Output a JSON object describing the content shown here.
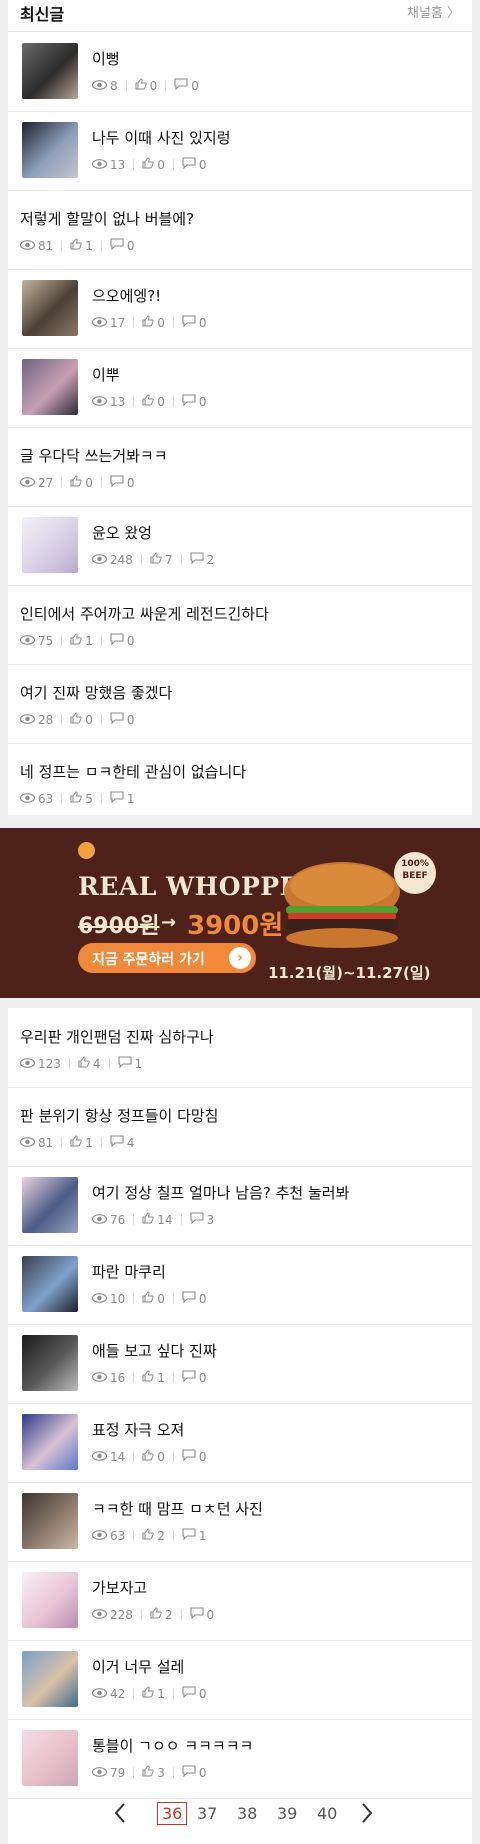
{
  "header": {
    "title": "최신글",
    "home_link": "채널홈 〉"
  },
  "list1": [
    {
      "title": "이뻥",
      "views": "8",
      "likes": "0",
      "comments": "0",
      "thumb": true,
      "colors": [
        "#6b6b6b",
        "#2a2a2a",
        "#b9a69a"
      ]
    },
    {
      "title": "나두 이때 사진 있지렁",
      "views": "13",
      "likes": "0",
      "comments": "0",
      "thumb": true,
      "colors": [
        "#1d2230",
        "#8e9fb8",
        "#c7c2cf"
      ]
    },
    {
      "title": "저렇게 할말이 없나 버블에?",
      "views": "81",
      "likes": "1",
      "comments": "0",
      "thumb": false
    },
    {
      "title": "으오에엥?!",
      "views": "17",
      "likes": "0",
      "comments": "0",
      "thumb": true,
      "colors": [
        "#c4b49f",
        "#4b3f36",
        "#8a7a6c"
      ]
    },
    {
      "title": "이뿌",
      "views": "13",
      "likes": "0",
      "comments": "0",
      "thumb": true,
      "colors": [
        "#6c6580",
        "#c7a0b4",
        "#2d2c34"
      ]
    },
    {
      "title": "글 우다닥 쓰는거봐ㅋㅋ",
      "views": "27",
      "likes": "0",
      "comments": "0",
      "thumb": false
    },
    {
      "title": "윤오 왔엉",
      "views": "248",
      "likes": "7",
      "comments": "2",
      "thumb": true,
      "colors": [
        "#f3f0f6",
        "#d9d2e6",
        "#b8abc9"
      ]
    },
    {
      "title": "인티에서 주어까고 싸운게 레전드긴하다",
      "views": "75",
      "likes": "1",
      "comments": "0",
      "thumb": false
    },
    {
      "title": "여기 진짜 망했음 좋겠다",
      "views": "28",
      "likes": "0",
      "comments": "0",
      "thumb": false
    },
    {
      "title": "네 정프는 ㅁㅋ한테 관심이 없습니다",
      "views": "63",
      "likes": "5",
      "comments": "1",
      "thumb": false
    }
  ],
  "ad": {
    "brand": "REAL WHOPPER®",
    "old_price": "6900원",
    "new_price": "3900원",
    "cta": "지금 주문하러 가기",
    "dates": "11.21(월)~11.27(일)",
    "badge": "100% BEEF",
    "colors": {
      "bg": "#4e2218",
      "accent": "#f08a3a",
      "cream": "#f5e7cf"
    }
  },
  "list2": [
    {
      "title": "우리판 개인팬덤 진짜 심하구나",
      "views": "123",
      "likes": "4",
      "comments": "1",
      "thumb": false
    },
    {
      "title": "판 분위기 항상 정프들이 다망침",
      "views": "81",
      "likes": "1",
      "comments": "4",
      "thumb": false
    },
    {
      "title": "여기 정상 칠프 얼마나 남음? 추천 눌러봐",
      "views": "76",
      "likes": "14",
      "comments": "3",
      "thumb": true,
      "colors": [
        "#e8d5dd",
        "#4b5a86",
        "#9aa3b8"
      ]
    },
    {
      "title": "파란 마쿠리",
      "views": "10",
      "likes": "0",
      "comments": "0",
      "thumb": true,
      "colors": [
        "#3d3f4f",
        "#7fa2cc",
        "#1e1e26"
      ]
    },
    {
      "title": "애들 보고 싶다 진짜",
      "views": "16",
      "likes": "1",
      "comments": "0",
      "thumb": true,
      "colors": [
        "#1a1a1a",
        "#5b5b5b",
        "#bdbdbd"
      ]
    },
    {
      "title": "표정 자극 오져",
      "views": "14",
      "likes": "0",
      "comments": "0",
      "thumb": true,
      "colors": [
        "#2c3b8a",
        "#d8c3d4",
        "#5a78c8"
      ]
    },
    {
      "title": "ㅋㅋ한 때 맘프 ㅁㅊ던 사진",
      "views": "63",
      "likes": "2",
      "comments": "1",
      "thumb": true,
      "colors": [
        "#3a3430",
        "#8c7b6d",
        "#c9b9a5"
      ]
    },
    {
      "title": "가보자고",
      "views": "228",
      "likes": "2",
      "comments": "0",
      "thumb": true,
      "colors": [
        "#fbeef4",
        "#e9c6d6",
        "#b58fb0"
      ]
    },
    {
      "title": "이거 너무 설레",
      "views": "42",
      "likes": "1",
      "comments": "0",
      "thumb": true,
      "colors": [
        "#7aa0c8",
        "#d9c2a8",
        "#3e6b8c"
      ]
    },
    {
      "title": "통블이 ㄱㅇㅇ ㅋㅋㅋㅋㅋ",
      "views": "79",
      "likes": "3",
      "comments": "0",
      "thumb": true,
      "colors": [
        "#f4dde8",
        "#e8bfc9",
        "#c9a7b8"
      ]
    }
  ],
  "pagination": {
    "pages": [
      "36",
      "37",
      "38",
      "39",
      "40"
    ],
    "current": "36"
  }
}
